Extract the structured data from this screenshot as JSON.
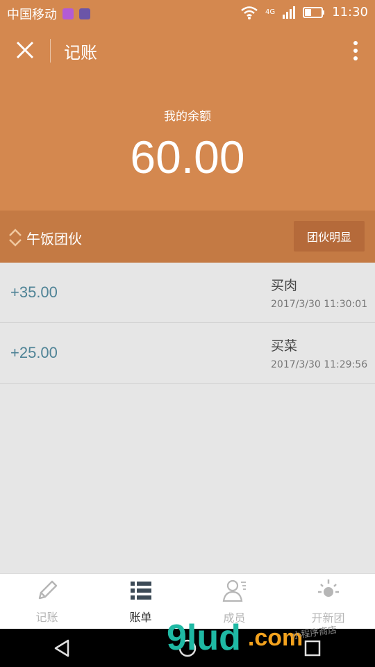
{
  "status_bar": {
    "carrier": "中国移动",
    "network": "4G",
    "time": "11:30"
  },
  "appbar": {
    "title": "记账"
  },
  "balance": {
    "label": "我的余额",
    "amount": "60.00"
  },
  "group": {
    "name": "午饭团伙",
    "detail_button": "团伙明显"
  },
  "transactions": [
    {
      "amount": "+35.00",
      "title": "买肉",
      "time": "2017/3/30 11:30:01"
    },
    {
      "amount": "+25.00",
      "title": "买菜",
      "time": "2017/3/30 11:29:56"
    }
  ],
  "tabs": [
    {
      "label": "记账",
      "icon": "pencil-icon"
    },
    {
      "label": "账单",
      "icon": "list-icon"
    },
    {
      "label": "成员",
      "icon": "person-icon"
    },
    {
      "label": "开新团",
      "icon": "sun-icon"
    }
  ],
  "watermark": {
    "big": "9lud",
    "com": ".com",
    "small": "小程序商店"
  },
  "colors": {
    "header": "#d4884f",
    "group_bar": "#c47a44",
    "accent_amount": "#4f8396"
  }
}
